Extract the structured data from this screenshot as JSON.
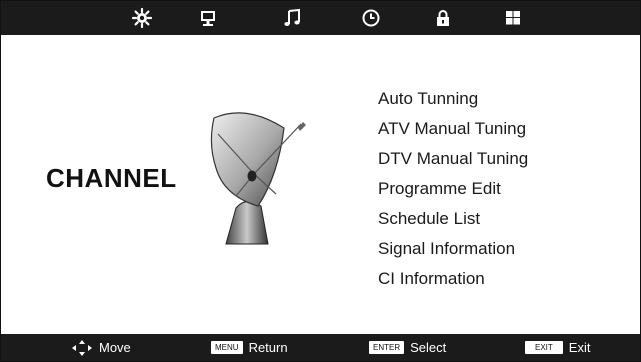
{
  "tabs": [
    {
      "icon": "picture-settings-icon",
      "selected": true
    },
    {
      "icon": "monitor-icon",
      "selected": false
    },
    {
      "icon": "music-note-icon",
      "selected": false
    },
    {
      "icon": "clock-icon",
      "selected": false
    },
    {
      "icon": "lock-icon",
      "selected": false
    },
    {
      "icon": "grid-icon",
      "selected": false
    }
  ],
  "page": {
    "title": "CHANNEL",
    "illustration": "satellite-dish-icon"
  },
  "menu": {
    "items": [
      "Auto Tunning",
      "ATV Manual Tuning",
      "DTV Manual Tuning",
      "Programme Edit",
      "Schedule List",
      "Signal Information",
      "CI Information"
    ]
  },
  "footer": {
    "move": {
      "label": "Move"
    },
    "return": {
      "key": "MENU",
      "label": "Return"
    },
    "select": {
      "key": "ENTER",
      "label": "Select"
    },
    "exit": {
      "key": "EXIT",
      "label": "Exit"
    }
  },
  "colors": {
    "bar": "#1b1b1b",
    "background": "#ffffff",
    "text": "#1a1a1a"
  }
}
